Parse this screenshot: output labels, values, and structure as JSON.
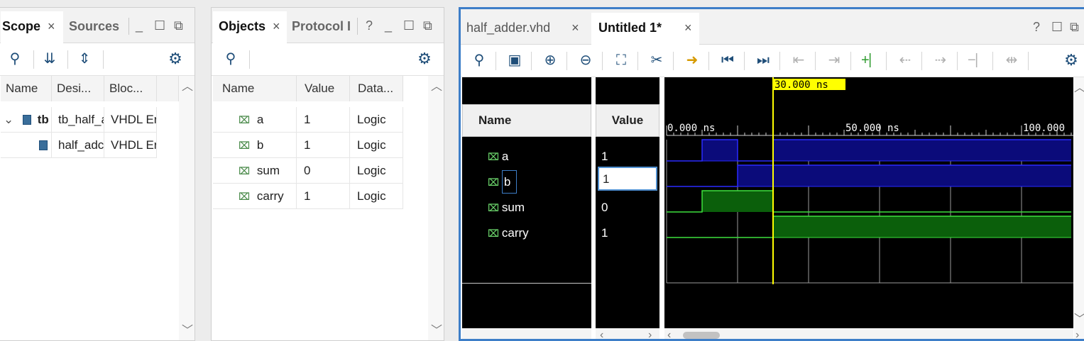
{
  "scope_panel": {
    "tabs": [
      {
        "label": "Scope",
        "active": true
      },
      {
        "label": "Sources",
        "active": false
      }
    ],
    "close_glyph": "×",
    "columns": [
      "Name",
      "Desi...",
      "Bloc..."
    ],
    "rows": [
      {
        "name": "tb",
        "design": "tb_half_a",
        "block": "VHDL Er"
      },
      {
        "name": "",
        "design": "half_adc",
        "block": "VHDL Er"
      }
    ],
    "icons": [
      "search-icon",
      "collapse-all-icon",
      "expand-all-icon",
      "gear-icon"
    ]
  },
  "objects_panel": {
    "tabs": [
      {
        "label": "Objects",
        "active": true
      },
      {
        "label": "Protocol I",
        "active": false
      }
    ],
    "close_glyph": "×",
    "help_glyph": "?",
    "columns": [
      "Name",
      "Value",
      "Data..."
    ],
    "rows": [
      {
        "name": "a",
        "value": "1",
        "type": "Logic"
      },
      {
        "name": "b",
        "value": "1",
        "type": "Logic"
      },
      {
        "name": "sum",
        "value": "0",
        "type": "Logic"
      },
      {
        "name": "carry",
        "value": "1",
        "type": "Logic"
      }
    ],
    "icons": [
      "search-icon",
      "gear-icon"
    ]
  },
  "wave_panel": {
    "tabs": [
      {
        "label": "half_adder.vhd",
        "active": false
      },
      {
        "label": "Untitled 1*",
        "active": true
      }
    ],
    "close_glyph": "×",
    "help_glyph": "?",
    "name_header": "Name",
    "value_header": "Value",
    "cursor_label": "30.000 ns",
    "timeline_labels": [
      "0.000 ns",
      "50.000 ns",
      "100.000"
    ],
    "signals": [
      {
        "name": "a",
        "value": "1"
      },
      {
        "name": "b",
        "value": "1"
      },
      {
        "name": "sum",
        "value": "0"
      },
      {
        "name": "carry",
        "value": "1"
      }
    ],
    "colors": {
      "bus_fill": "#0b0b7a",
      "bus_line": "#2a2aff",
      "logic_fill": "#0b5f0b",
      "logic_line": "#3ee03e",
      "cursor": "#ffff00"
    }
  }
}
